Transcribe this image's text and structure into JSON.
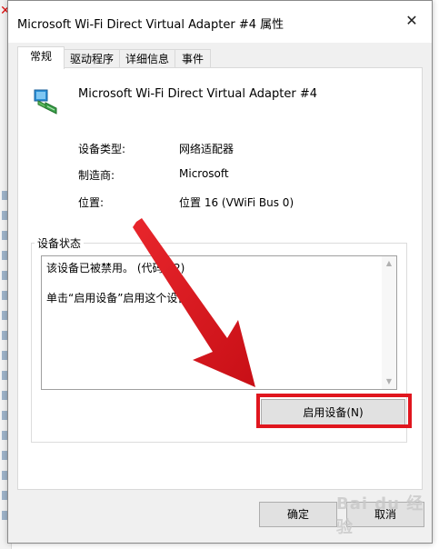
{
  "window": {
    "title": "Microsoft Wi-Fi Direct Virtual Adapter #4 属性",
    "close_glyph": "✕"
  },
  "tabs": [
    {
      "label": "常规",
      "active": true
    },
    {
      "label": "驱动程序",
      "active": false
    },
    {
      "label": "详细信息",
      "active": false
    },
    {
      "label": "事件",
      "active": false
    }
  ],
  "device": {
    "name": "Microsoft Wi-Fi Direct Virtual Adapter #4",
    "icon": "network-adapter-icon",
    "properties": [
      {
        "label": "设备类型:",
        "value": "网络适配器"
      },
      {
        "label": "制造商:",
        "value": "Microsoft"
      },
      {
        "label": "位置:",
        "value": "位置 16 (VWiFi Bus 0)"
      }
    ]
  },
  "status": {
    "group_title": "设备状态",
    "line1": "该设备已被禁用。 (代码 22)",
    "line2": "单击“启用设备”启用这个设备。"
  },
  "buttons": {
    "enable": "启用设备(N)",
    "ok": "确定",
    "cancel": "取消"
  },
  "annotation": {
    "highlight_color": "#e0161e",
    "arrow_color": "#e0161e"
  },
  "watermark": "Bai du 经验"
}
